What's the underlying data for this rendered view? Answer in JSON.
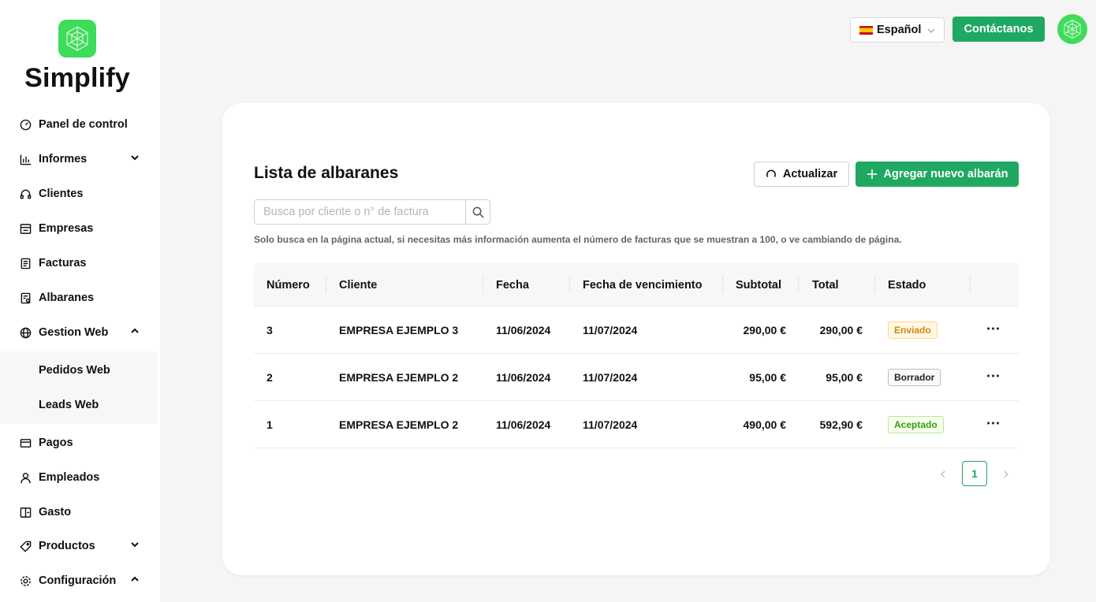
{
  "brand": {
    "name": "Simplify"
  },
  "sidebar": {
    "items": [
      {
        "label": "Panel de control",
        "icon": "dashboard-icon"
      },
      {
        "label": "Informes",
        "icon": "bar-chart-icon",
        "chevron": "down"
      },
      {
        "label": "Clientes",
        "icon": "headset-icon"
      },
      {
        "label": "Empresas",
        "icon": "shop-icon"
      },
      {
        "label": "Facturas",
        "icon": "invoice-icon"
      },
      {
        "label": "Albaranes",
        "icon": "delivery-note-icon"
      },
      {
        "label": "Gestion Web",
        "icon": "globe-icon",
        "chevron": "up"
      },
      {
        "label": "Pedidos Web",
        "sub": true
      },
      {
        "label": "Leads Web",
        "sub": true
      },
      {
        "label": "Pagos",
        "icon": "wallet-icon"
      },
      {
        "label": "Empleados",
        "icon": "user-icon"
      },
      {
        "label": "Gasto",
        "icon": "expense-icon"
      },
      {
        "label": "Productos",
        "icon": "tag-icon",
        "chevron": "down"
      },
      {
        "label": "Configuración",
        "icon": "gear-icon",
        "chevron": "up"
      }
    ]
  },
  "header": {
    "language": "Español",
    "contact_label": "Contáctanos"
  },
  "main": {
    "title": "Lista de albaranes",
    "refresh_label": "Actualizar",
    "add_label": "Agregar nuevo albarán",
    "search_placeholder": "Busca por cliente o n° de factura",
    "hint": "Solo busca en la página actual, si necesitas más información aumenta el número de facturas que se muestran a 100, o ve cambiando de página.",
    "columns": [
      "Número",
      "Cliente",
      "Fecha",
      "Fecha de vencimiento",
      "Subtotal",
      "Total",
      "Estado"
    ],
    "rows": [
      {
        "numero": "3",
        "cliente": "EMPRESA EJEMPLO 3",
        "fecha": "11/06/2024",
        "vencimiento": "11/07/2024",
        "subtotal": "290,00 €",
        "total": "290,00 €",
        "estado": "Enviado",
        "estado_color": "#d48806"
      },
      {
        "numero": "2",
        "cliente": "EMPRESA EJEMPLO 2",
        "fecha": "11/06/2024",
        "vencimiento": "11/07/2024",
        "subtotal": "95,00 €",
        "total": "95,00 €",
        "estado": "Borrador",
        "estado_color": "#222222"
      },
      {
        "numero": "1",
        "cliente": "EMPRESA EJEMPLO 2",
        "fecha": "11/06/2024",
        "vencimiento": "11/07/2024",
        "subtotal": "490,00 €",
        "total": "592,90 €",
        "estado": "Aceptado",
        "estado_color": "#389e0d"
      }
    ],
    "pagination": {
      "current": "1"
    }
  },
  "colors": {
    "accent": "#1fa861",
    "logo": "#3ddc5a"
  }
}
